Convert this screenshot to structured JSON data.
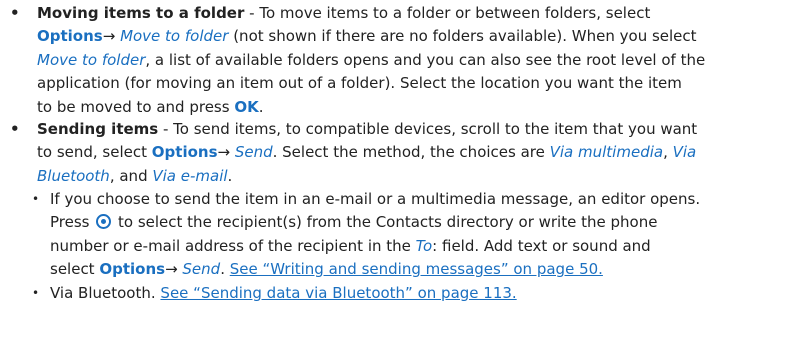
{
  "items": [
    {
      "title": "Moving items to a folder",
      "lines": [
        [
          {
            "t": "b",
            "v": "Moving items to a folder"
          },
          {
            "t": "n",
            "v": " - To move items to a folder or between folders, select"
          }
        ],
        [
          {
            "t": "kw",
            "v": "Options"
          },
          {
            "t": "n",
            "v": "→ "
          },
          {
            "t": "it",
            "v": "Move to folder"
          },
          {
            "t": "n",
            "v": " (not shown if there are no folders available). When you select"
          }
        ],
        [
          {
            "t": "it",
            "v": "Move to folder"
          },
          {
            "t": "n",
            "v": ", a list of available folders opens and you can also see the root level of the"
          }
        ],
        [
          {
            "t": "n",
            "v": "application (for moving an item out of a folder). Select the location you want the item"
          }
        ],
        [
          {
            "t": "n",
            "v": "to be moved to and press "
          },
          {
            "t": "kw",
            "v": "OK"
          },
          {
            "t": "n",
            "v": "."
          }
        ]
      ]
    },
    {
      "title": "Sending items",
      "lines": [
        [
          {
            "t": "b",
            "v": "Sending items"
          },
          {
            "t": "n",
            "v": " - To send items, to compatible devices, scroll to the item that you want"
          }
        ],
        [
          {
            "t": "n",
            "v": "to send, select "
          },
          {
            "t": "kw",
            "v": "Options"
          },
          {
            "t": "n",
            "v": "→ "
          },
          {
            "t": "it",
            "v": "Send"
          },
          {
            "t": "n",
            "v": ". Select the method, the choices are "
          },
          {
            "t": "it",
            "v": "Via multimedia"
          },
          {
            "t": "n",
            "v": ", "
          },
          {
            "t": "it",
            "v": "Via"
          }
        ],
        [
          {
            "t": "it",
            "v": "Bluetooth"
          },
          {
            "t": "n",
            "v": ", and "
          },
          {
            "t": "it",
            "v": "Via e-mail"
          },
          {
            "t": "n",
            "v": "."
          }
        ]
      ],
      "subitems": [
        {
          "lines": [
            [
              {
                "t": "n",
                "v": "If you choose to send the item in an e-mail or a multimedia message, an editor opens."
              }
            ],
            [
              {
                "t": "n",
                "v": "Press "
              },
              {
                "t": "icon",
                "v": "navigation-key-icon"
              },
              {
                "t": "n",
                "v": " to select the recipient(s) from the Contacts directory or write the phone"
              }
            ],
            [
              {
                "t": "n",
                "v": "number or e-mail address of the recipient in the "
              },
              {
                "t": "it",
                "v": "To"
              },
              {
                "t": "n",
                "v": ": field. Add text or sound and"
              }
            ],
            [
              {
                "t": "n",
                "v": "select "
              },
              {
                "t": "kw",
                "v": "Options"
              },
              {
                "t": "n",
                "v": "→ "
              },
              {
                "t": "it",
                "v": "Send"
              },
              {
                "t": "n",
                "v": ". "
              },
              {
                "t": "link",
                "v": "See “Writing and sending messages” on page 50."
              }
            ]
          ]
        },
        {
          "lines": [
            [
              {
                "t": "n",
                "v": "Via Bluetooth. "
              },
              {
                "t": "link",
                "v": "See “Sending data via Bluetooth” on page 113."
              }
            ]
          ]
        }
      ]
    }
  ],
  "bullet_glyph": "•",
  "colors": {
    "accent": "#1a6fc0",
    "text": "#222222"
  }
}
